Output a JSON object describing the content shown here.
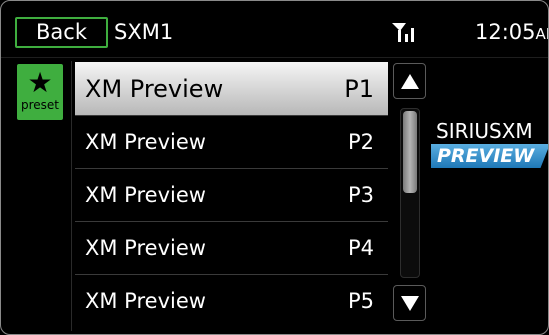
{
  "header": {
    "back_label": "Back",
    "title": "SXM1",
    "signal_icon": "signal-strength-icon",
    "clock_time": "12:05",
    "clock_ampm": "AM"
  },
  "preset_tab": {
    "icon": "star-icon",
    "label": "preset",
    "accent_color": "#3fae3f"
  },
  "channels": [
    {
      "name": "XM Preview",
      "preset": "P1",
      "selected": true
    },
    {
      "name": "XM Preview",
      "preset": "P2",
      "selected": false
    },
    {
      "name": "XM Preview",
      "preset": "P3",
      "selected": false
    },
    {
      "name": "XM Preview",
      "preset": "P4",
      "selected": false
    },
    {
      "name": "XM Preview",
      "preset": "P5",
      "selected": false
    }
  ],
  "scroll": {
    "up_icon": "arrow-up-icon",
    "down_icon": "arrow-down-icon",
    "position": 0.0
  },
  "logo": {
    "brand": "SIRIUSXM",
    "tagline": "PREVIEW",
    "band_color": "#2a8ccc"
  }
}
